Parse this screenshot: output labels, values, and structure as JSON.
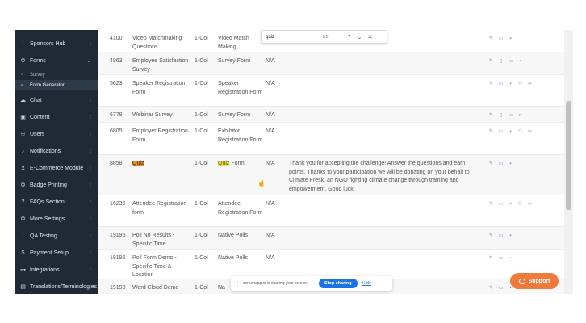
{
  "sidebar": {
    "items": [
      {
        "label": "Sponsors Hub",
        "icon": "chart-icon",
        "glyph": "⌇"
      },
      {
        "label": "Forms",
        "icon": "gear-icon",
        "glyph": "⚙"
      },
      {
        "label": "Chat",
        "icon": "chat-icon",
        "glyph": "☁"
      },
      {
        "label": "Content",
        "icon": "image-icon",
        "glyph": "▣"
      },
      {
        "label": "Users",
        "icon": "users-icon",
        "glyph": "👥"
      },
      {
        "label": "Notifications",
        "icon": "bell-icon",
        "glyph": "🔔"
      },
      {
        "label": "E-Commerce Module",
        "icon": "cart-icon",
        "glyph": "🛒"
      },
      {
        "label": "Badge Printing",
        "icon": "gear-icon",
        "glyph": "⚙"
      },
      {
        "label": "FAQs Section",
        "icon": "question-icon",
        "glyph": "?"
      },
      {
        "label": "More Settings",
        "icon": "gear-icon",
        "glyph": "⚙"
      },
      {
        "label": "QA Testing",
        "icon": "chart-icon",
        "glyph": "⌇"
      },
      {
        "label": "Payment Setup",
        "icon": "dollar-icon",
        "glyph": "$"
      },
      {
        "label": "Integrations",
        "icon": "plug-icon",
        "glyph": "⊶"
      },
      {
        "label": "Translations/Terminologies",
        "icon": "book-icon",
        "glyph": "▤"
      }
    ],
    "forms_sub": [
      {
        "label": "Survey"
      },
      {
        "label": "Form Generator"
      }
    ]
  },
  "table": {
    "rows": [
      {
        "id": "4100",
        "name": "Video Matchmaking Questions",
        "cols": "1-Col",
        "type": "Video Match Making",
        "na": "",
        "desc": ""
      },
      {
        "id": "4863",
        "name": "Employee Satisfaction Survey",
        "cols": "1-Col",
        "type": "Survey Form",
        "na": "N/A",
        "desc": ""
      },
      {
        "id": "5623",
        "name": "Speaker Registration Form",
        "cols": "1-Col",
        "type": "Speaker Registration Form",
        "na": "N/A",
        "desc": ""
      },
      {
        "id": "6778",
        "name": "Webinar Survey",
        "cols": "1-Col",
        "type": "Survey Form",
        "na": "N/A",
        "desc": ""
      },
      {
        "id": "6805",
        "name": "Employer Registration Form",
        "cols": "1-Col",
        "type": "Exhibitor Registration Form",
        "na": "N/A",
        "desc": ""
      },
      {
        "id": "8858",
        "name": "Quiz",
        "cols": "1-Col",
        "type_hl": "Quiz",
        "type_rest": " Form",
        "na": "N/A",
        "desc": "Thank you for accepting the challenge! Answer the questions and earn points. Thanks to your participation we will be donating on your behalf to Climate Fresk, an NGO fighting climate change through training and empowerment. Good luck!"
      },
      {
        "id": "16235",
        "name": "Attendee Registration form",
        "cols": "1-Col",
        "type": "Attendee Registration Form",
        "na": "N/A",
        "desc": ""
      },
      {
        "id": "19195",
        "name": "Poll No Results - Specific Time",
        "cols": "1-Col",
        "type": "Native Polls",
        "na": "N/A",
        "desc": ""
      },
      {
        "id": "19196",
        "name": "Poll Form Demo - Specific Time & Location",
        "cols": "1-Col",
        "type": "Native Polls",
        "na": "N/A",
        "desc": ""
      },
      {
        "id": "19198",
        "name": "Word Cloud Demo",
        "cols": "1-Col",
        "type": "Na",
        "na": "",
        "desc": ""
      }
    ]
  },
  "findbar": {
    "query": "quiz",
    "count": "1/2"
  },
  "sharebar": {
    "text": "screenapp.io is sharing your screen.",
    "stop_label": "Stop sharing",
    "hide_label": "Hide"
  },
  "support": {
    "label": "Support"
  },
  "colors": {
    "sidebar_bg": "#1f2a36",
    "highlight": "#f5e13c",
    "highlight_current": "#f08c2a",
    "support": "#f07a3c",
    "stop_button": "#1a73e8"
  }
}
